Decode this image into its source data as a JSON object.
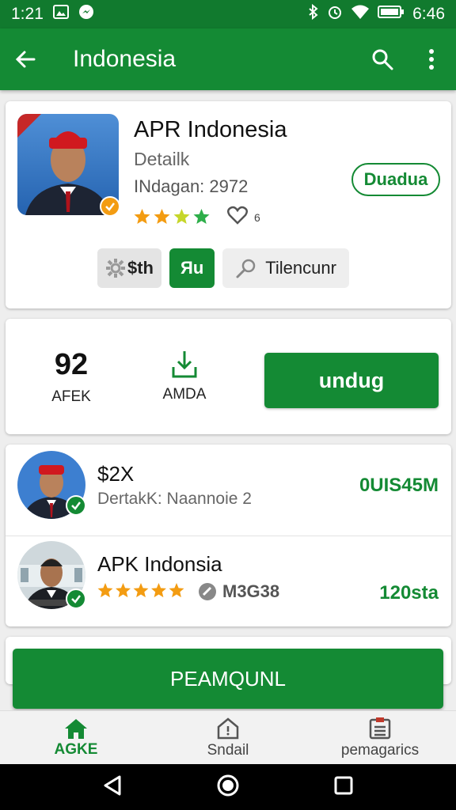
{
  "status_bar": {
    "time_left": "1:21",
    "time_right": "6:46",
    "icons": [
      "image-icon",
      "messenger-icon",
      "bluetooth-icon",
      "alarm-icon",
      "wifi-icon",
      "battery-icon"
    ]
  },
  "app_bar": {
    "title": "Indonesia",
    "icons": [
      "back-arrow-icon",
      "search-icon",
      "more-vert-icon"
    ]
  },
  "hero": {
    "app_name": "APR Indonesia",
    "developer": "Detailk",
    "downloads": "INdagan: 2972",
    "rating_stars": 4,
    "review_count": "6",
    "outline_button": "Duadua",
    "chips": {
      "settings_chip": "$th",
      "green_chip": "Яu",
      "search_chip": "Tilencunr"
    }
  },
  "stats": {
    "rating_value": "92",
    "rating_label": "AFEK",
    "download_label": "AMDA",
    "install_button": "undug"
  },
  "list": [
    {
      "title": "$2X",
      "subtitle": "DertakK: Naannoie 2",
      "right": "0UIS45M"
    },
    {
      "title": "APK Indonsia",
      "rating_stars": 5,
      "meta": "M3G38",
      "right": "120sta"
    }
  ],
  "bottom_button": "PEAMQUNL",
  "bottom_nav": [
    {
      "label": "AGKE",
      "icon": "home-icon",
      "active": true
    },
    {
      "label": "Sndail",
      "icon": "house-outline-icon",
      "active": false
    },
    {
      "label": "pemagarics",
      "icon": "list-icon",
      "active": false
    }
  ],
  "colors": {
    "primary": "#148a34",
    "status_bar": "#117a2e",
    "star": "#f39c12",
    "background": "#eeeeee"
  }
}
